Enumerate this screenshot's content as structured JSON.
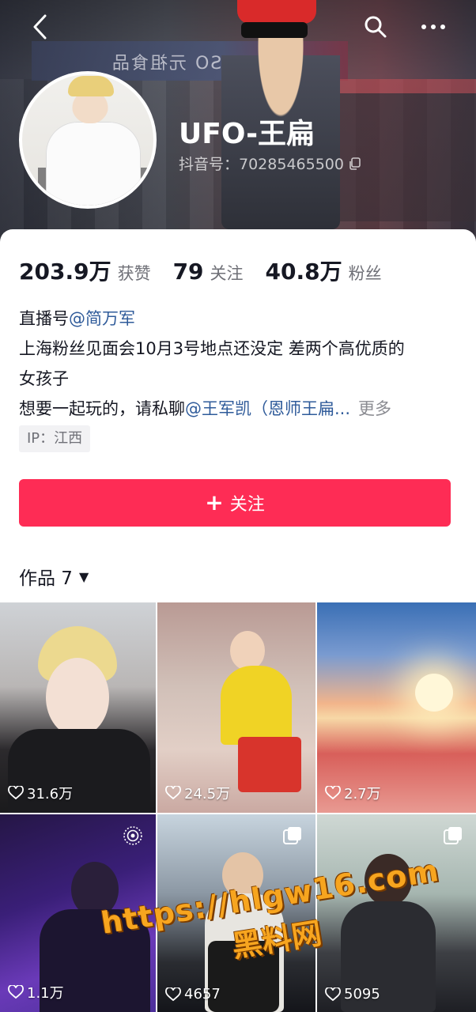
{
  "header": {
    "nickname": "UFO-王扁",
    "douyin_id": "抖音号：70285465500",
    "cover_sign_text": "ANSO 元祖食品"
  },
  "icons": {
    "back": "chevron-left-icon",
    "search": "search-icon",
    "more": "more-dots-icon",
    "copy": "copy-icon",
    "heart": "heart-icon",
    "live": "live-ring-icon",
    "multi": "multi-image-icon",
    "plus": "plus-icon",
    "caret": "caret-down-icon"
  },
  "stats": [
    {
      "value": "203.9万",
      "label": "获赞"
    },
    {
      "value": "79",
      "label": "关注"
    },
    {
      "value": "40.8万",
      "label": "粉丝"
    }
  ],
  "bio": {
    "line1_prefix": "直播号",
    "line1_mention": "@简万军",
    "line2": "上海粉丝见面会10月3号地点还没定 差两个高优质的",
    "line3": "女孩子",
    "line4_prefix": "想要一起玩的，请私聊",
    "line4_mention": "@王军凯（恩师王扁...",
    "more": "更多"
  },
  "ip": "IP：江西",
  "follow_button": {
    "plus": "+",
    "label": "关注"
  },
  "works_tab": {
    "label": "作品 7",
    "caret": "▼"
  },
  "videos": [
    {
      "likes": "31.6万"
    },
    {
      "likes": "24.5万"
    },
    {
      "likes": "2.7万"
    },
    {
      "likes": "1.1万"
    },
    {
      "likes": "4657"
    },
    {
      "likes": "5095"
    }
  ],
  "watermark": {
    "url": "https://hlgw16.com",
    "name": "黑料网"
  },
  "colors": {
    "accent": "#fe2c55",
    "mention": "#2f5b9a",
    "watermark": "#f7a51f"
  }
}
